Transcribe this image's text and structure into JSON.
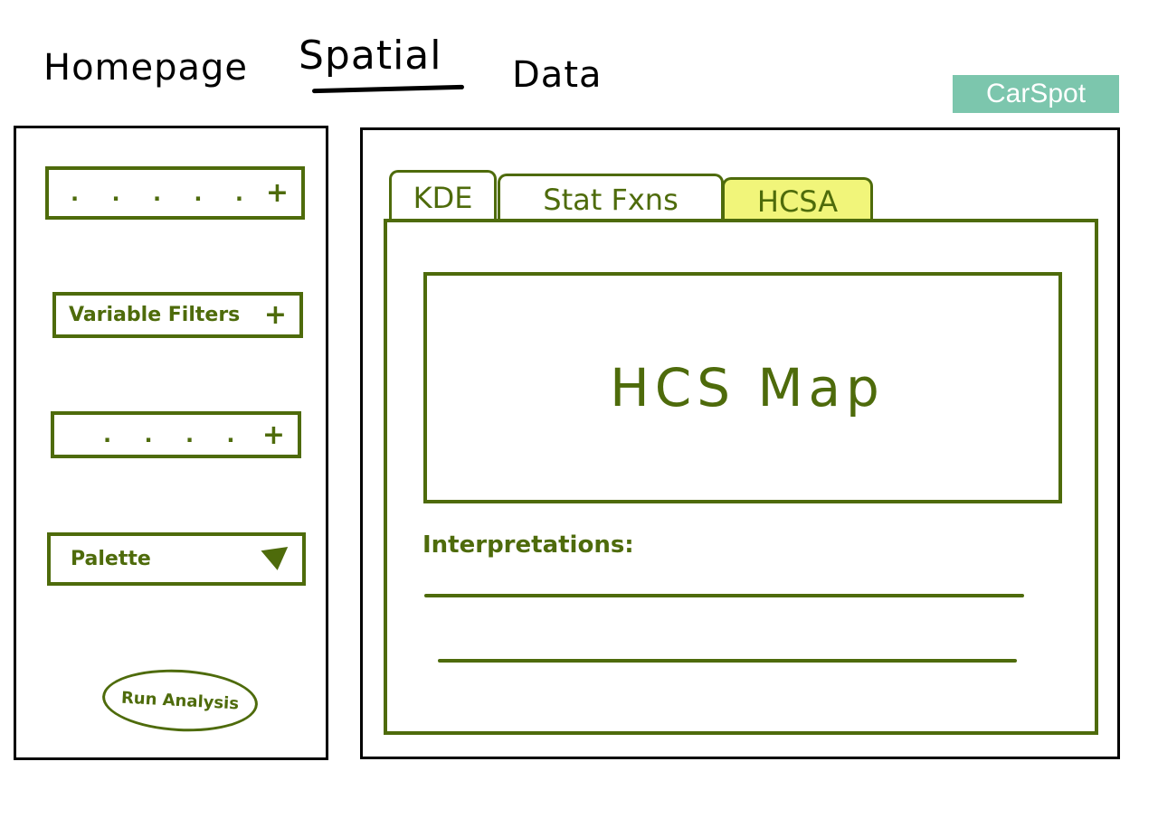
{
  "nav": {
    "home": "Homepage",
    "spatial": "Spatial",
    "data": "Data"
  },
  "brand": "CarSpot",
  "sidebar": {
    "filters": [
      {
        "label": ". . . . .",
        "action": "+"
      },
      {
        "label": "Variable Filters",
        "action": "+"
      },
      {
        "label": ". . . .",
        "action": "+"
      }
    ],
    "palette": {
      "label": "Palette"
    },
    "run_button": "Run Analysis"
  },
  "tabs": [
    {
      "label": "KDE",
      "active": false
    },
    {
      "label": "Stat Fxns",
      "active": false
    },
    {
      "label": "HCSA",
      "active": true
    }
  ],
  "main": {
    "map_label": "HCS Map",
    "interpretations_label": "Interpretations:"
  },
  "colors": {
    "sketch_green": "#4e6b0b",
    "brand_teal": "#7cc6ad",
    "active_tab_highlight": "#f1f57a"
  },
  "icons": {
    "palette_dropdown": "triangle-down-icon",
    "expand": "plus-icon"
  }
}
